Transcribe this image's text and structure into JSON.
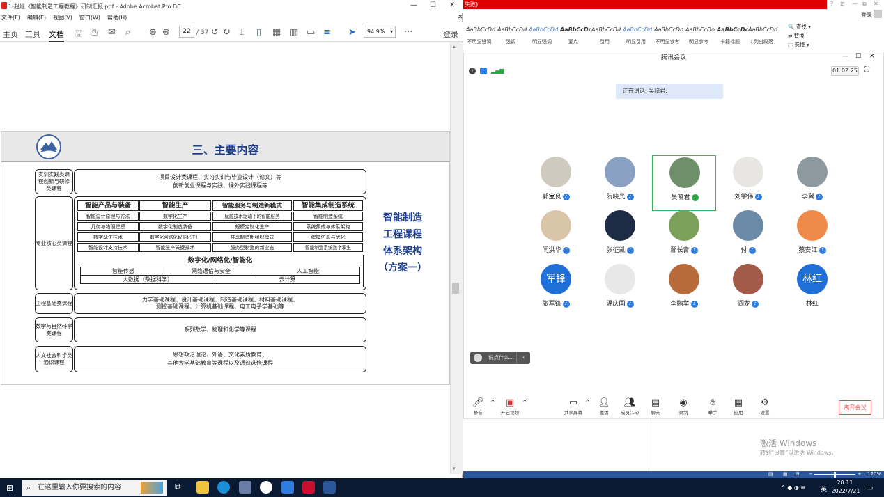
{
  "acrobat": {
    "title": "1-赵继《智能制造工程教程》研制汇报.pdf - Adobe Acrobat Pro DC",
    "menu": [
      "文件(F)",
      "编辑(E)",
      "视图(V)",
      "窗口(W)",
      "帮助(H)"
    ],
    "tabs": [
      "主页",
      "工具",
      "文档"
    ],
    "page_current": "22",
    "page_total": "/ 37",
    "zoom": "94.9%",
    "login": "登录"
  },
  "slide": {
    "title": "三、主要内容",
    "side_title": [
      "智能制造",
      "工程课程",
      "体系架构",
      "（方案一）"
    ],
    "rows": [
      {
        "label": "实训实践类课程创新与研修类课程",
        "content": "项目设计类课程、实习实训与毕业设计（论文）等\n创新创业课程与实践、课外实践课程等"
      },
      {
        "label": "工程基础类课程",
        "content": "力学基础课程、设计基础课程、制造基础课程、材料基础课程、\n测控基础课程、计算机基础课程、电工电子学基础等"
      },
      {
        "label": "数学与自然科学类课程",
        "content": "系列数学、物理和化学等课程"
      },
      {
        "label": "人文社会科学类通识课程",
        "content": "思想政治理论、外语、文化素质教育、\n其他大学基础教育等课程以及通识选修课程"
      }
    ],
    "core_label": "专业核心类课程",
    "columns": [
      {
        "header": "智能产品与装备",
        "items": [
          "智能设计原理与方法",
          "几何与物理建模",
          "数字孪生技术",
          "智能设计支持技术"
        ]
      },
      {
        "header": "智能生产",
        "items": [
          "数字化生产",
          "数字化制造装备",
          "数字化网络化智能化工厂",
          "智能生产关键技术"
        ]
      },
      {
        "header": "智能服务与制造新模式",
        "items": [
          "赋能技术驱动下的智能服务",
          "规模定制化生产",
          "共享制造新组织模式",
          "服务型制造的新业态"
        ]
      },
      {
        "header": "智能集成制造系统",
        "items": [
          "智能制造系统",
          "系统集成与体系架构",
          "建模仿真与优化",
          "智能制造系统数字孪生"
        ]
      }
    ],
    "digital": {
      "header": "数字化/网络化/智能化",
      "row1": [
        "智能传感",
        "网络通信与安全",
        "人工智能"
      ],
      "row2": [
        "大数据（数据科学）",
        "云计算"
      ]
    }
  },
  "word": {
    "red_bar_text": "失败)",
    "styles": [
      {
        "sample": "AaBbCcDd",
        "name": "不明显强调"
      },
      {
        "sample": "AaBbCcDd",
        "name": "强调"
      },
      {
        "sample": "AaBbCcDd",
        "name": "明显强调"
      },
      {
        "sample": "AaBbCcDc",
        "name": "要点"
      },
      {
        "sample": "AaBbCcDd",
        "name": "引用"
      },
      {
        "sample": "AaBbCcDd",
        "name": "明显引用"
      },
      {
        "sample": "AaBbCcDo",
        "name": "不明显参考"
      },
      {
        "sample": "AaBbCcDo",
        "name": "明显参考"
      },
      {
        "sample": "AaBbCcDc",
        "name": "书籍标题"
      },
      {
        "sample": "AaBbCcDd",
        "name": "↓列出段落"
      }
    ],
    "find": "查找",
    "replace": "替换",
    "select": "选择",
    "login": "登录",
    "activate_title": "激活 Windows",
    "activate_sub": "转到“设置”以激活 Windows。",
    "zoom": "120%"
  },
  "meeting": {
    "title": "腾讯会议",
    "timer": "01:02:25",
    "speaking": "正在讲话: 吴晓君;",
    "participants": [
      {
        "name": "郭宝良",
        "mic": "blue"
      },
      {
        "name": "阮晓光",
        "mic": "blue"
      },
      {
        "name": "吴晓君",
        "mic": "green"
      },
      {
        "name": "刘学伟",
        "mic": "blue"
      },
      {
        "name": "李冀",
        "mic": "blue"
      },
      {
        "name": "闫洪华",
        "mic": "blue"
      },
      {
        "name": "张征凯",
        "mic": "blue"
      },
      {
        "name": "鄢长青",
        "mic": "blue"
      },
      {
        "name": "付",
        "mic": "blue"
      },
      {
        "name": "蔡安江",
        "mic": "blue"
      },
      {
        "name": "张军锋",
        "mic": "blue",
        "initials": "军锋"
      },
      {
        "name": "温庆国",
        "mic": "blue"
      },
      {
        "name": "李鹏举",
        "mic": "blue"
      },
      {
        "name": "阎龙",
        "mic": "blue"
      },
      {
        "name": "林红",
        "mic": "none",
        "initials": "林红"
      }
    ],
    "chat_placeholder": "说点什么...",
    "toolbar": [
      "静音",
      "开启视频",
      "共享屏幕",
      "邀请",
      "成员(15)",
      "聊天",
      "录制",
      "举手",
      "应用",
      "设置"
    ],
    "leave": "离开会议"
  },
  "taskbar": {
    "search_placeholder": "在这里输入你要搜索的内容",
    "ime": "英",
    "time": "20:11",
    "date": "2022/7/21"
  }
}
